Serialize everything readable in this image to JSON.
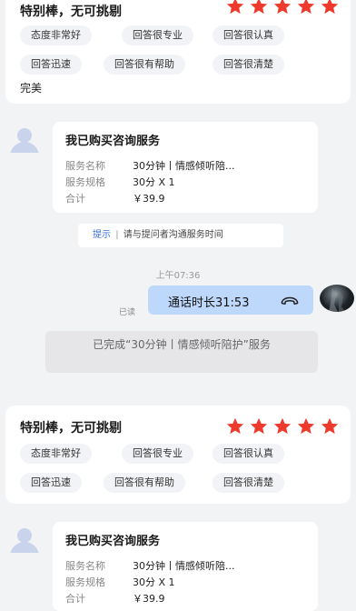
{
  "review_1": {
    "title": "特别棒，无可挑剔",
    "stars": 5,
    "tags": [
      "态度非常好",
      "回答很专业",
      "回答很认真",
      "回答迅速",
      "回答很有帮助",
      "回答很清楚"
    ],
    "remark": "完美"
  },
  "order_1": {
    "title": "我已购买咨询服务",
    "rows": [
      {
        "label": "服务名称",
        "value": "30分钟丨情感倾听陪..."
      },
      {
        "label": "服务规格",
        "value": "30分 X 1"
      },
      {
        "label": "合计",
        "value": "￥39.9"
      }
    ]
  },
  "hint": {
    "label": "提示",
    "separator": "|",
    "text": "请与提问者沟通服务时间"
  },
  "timestamp": "上午07:36",
  "call_message": {
    "text": "通话时长31:53",
    "status": "已读",
    "icon": "phone-hangup-icon"
  },
  "completion_notice": "已完成“30分钟丨情感倾听陪护”服务",
  "review_2": {
    "title": "特别棒，无可挑剔",
    "stars": 5,
    "tags": [
      "态度非常好",
      "回答很专业",
      "回答很认真",
      "回答迅速",
      "回答很有帮助",
      "回答很清楚"
    ]
  },
  "order_2": {
    "title": "我已购买咨询服务",
    "rows": [
      {
        "label": "服务名称",
        "value": "30分钟丨情感倾听陪..."
      },
      {
        "label": "服务规格",
        "value": "30分 X 1"
      },
      {
        "label": "合计",
        "value": "￥39.9"
      }
    ]
  },
  "colors": {
    "star": "#ee3a2c",
    "accent": "#3b6fd8",
    "bubble": "#bed8fb"
  }
}
